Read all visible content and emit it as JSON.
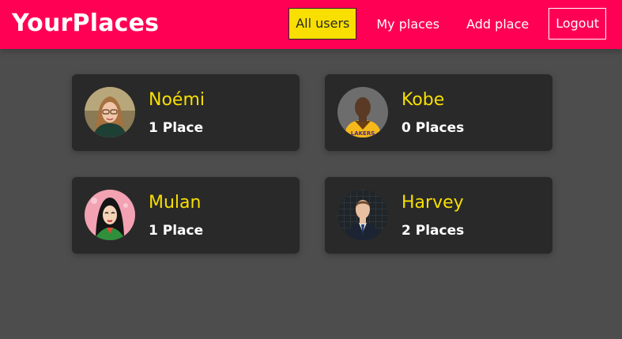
{
  "brand": {
    "title": "YourPlaces"
  },
  "nav": {
    "items": [
      {
        "label": "All users",
        "active": true
      },
      {
        "label": "My places",
        "active": false
      },
      {
        "label": "Add place",
        "active": false
      },
      {
        "label": "Logout",
        "active": false
      }
    ]
  },
  "colors": {
    "header": "#ff0055",
    "background": "#4d4d4d",
    "card": "#292929",
    "accent_yellow": "#f8df00",
    "text": "#ffffff"
  },
  "users": [
    {
      "name": "Noémi",
      "places": "1 Place",
      "avatar": "woman-glasses-portrait"
    },
    {
      "name": "Kobe",
      "places": "0 Places",
      "avatar": "basketball-player-portrait"
    },
    {
      "name": "Mulan",
      "places": "1 Place",
      "avatar": "animated-character-portrait"
    },
    {
      "name": "Harvey",
      "places": "2 Places",
      "avatar": "man-in-suit-portrait"
    }
  ]
}
